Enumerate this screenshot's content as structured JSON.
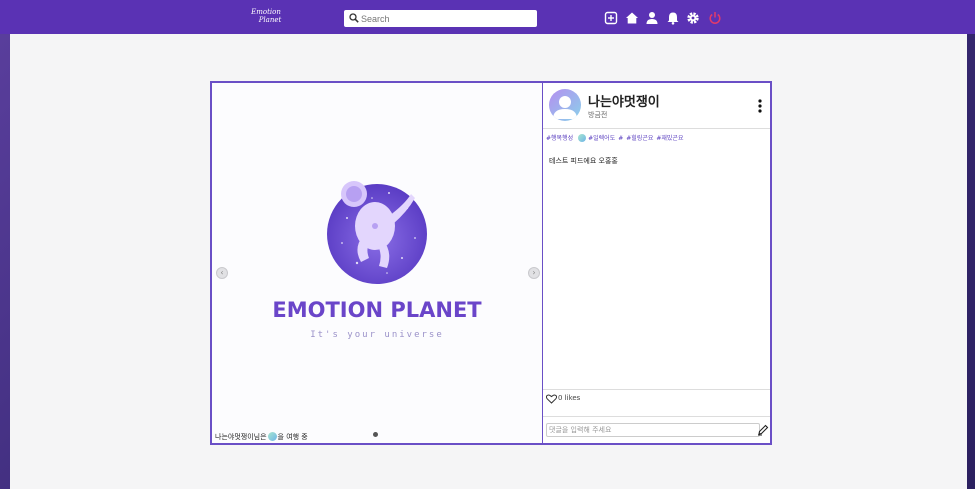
{
  "header": {
    "logo_line1": "Emotion",
    "logo_line2": "Planet",
    "search_placeholder": "Search",
    "nav_icons": [
      "add-square-icon",
      "home-icon",
      "user-icon",
      "bell-icon",
      "gear-icon",
      "power-icon"
    ]
  },
  "post": {
    "image": {
      "brand": "EMOTION PLANET",
      "tagline": "It's your universe"
    },
    "status_name": "나는야멋쟁이님은",
    "status_suffix": "을 여행 중",
    "author": {
      "name": "나는야멋쟁이",
      "time": "방금전"
    },
    "tags": [
      "#행복행성",
      "#일렉어도",
      "#",
      "#힐링곤요",
      "#재밌곤요"
    ],
    "content": "테스트 피드에요 오홍홍",
    "likes": "0 likes",
    "comment_placeholder": "댓글을 입력해 주세요"
  },
  "colors": {
    "brand": "#5a32b4",
    "accent": "#6a4fc6",
    "power": "#e23a6a"
  }
}
